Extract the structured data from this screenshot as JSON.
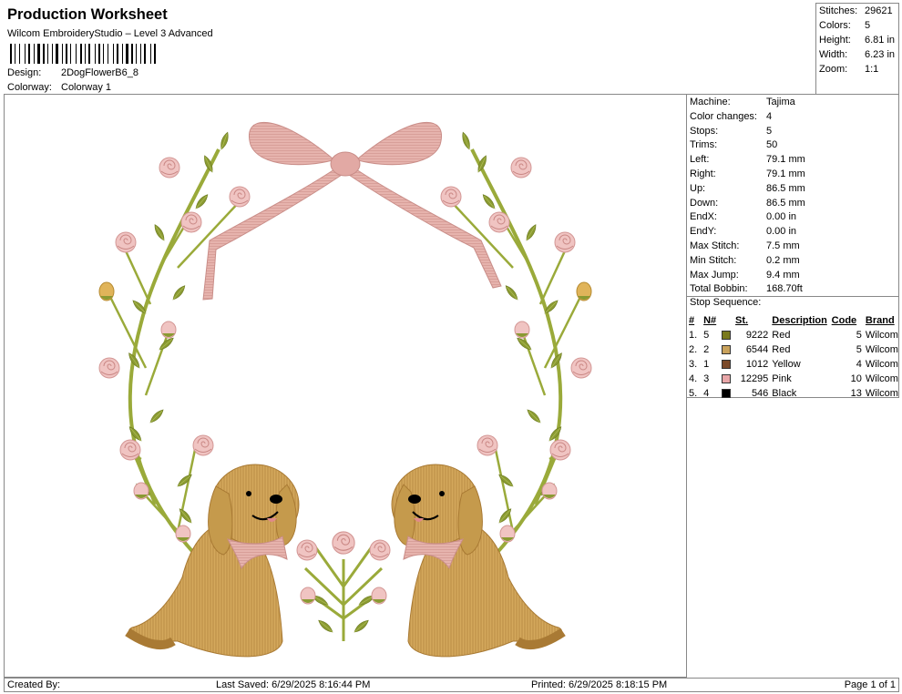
{
  "header": {
    "title": "Production Worksheet",
    "subtitle": "Wilcom EmbroideryStudio – Level 3 Advanced",
    "design_label": "Design:",
    "design_value": "2DogFlowerB6_8",
    "colorway_label": "Colorway:",
    "colorway_value": "Colorway 1"
  },
  "stats": [
    {
      "label": "Stitches:",
      "value": "29621"
    },
    {
      "label": "Colors:",
      "value": "5"
    },
    {
      "label": "Height:",
      "value": "6.81 in"
    },
    {
      "label": "Width:",
      "value": "6.23 in"
    },
    {
      "label": "Zoom:",
      "value": "1:1"
    }
  ],
  "machine_info": [
    {
      "label": "Machine:",
      "value": "Tajima"
    },
    {
      "label": "Color changes:",
      "value": "4"
    },
    {
      "label": "Stops:",
      "value": "5"
    },
    {
      "label": "Trims:",
      "value": "50"
    },
    {
      "label": "Left:",
      "value": "79.1 mm"
    },
    {
      "label": "Right:",
      "value": "79.1 mm"
    },
    {
      "label": "Up:",
      "value": "86.5 mm"
    },
    {
      "label": "Down:",
      "value": "86.5 mm"
    },
    {
      "label": "EndX:",
      "value": "0.00 in"
    },
    {
      "label": "EndY:",
      "value": "0.00 in"
    },
    {
      "label": "Max Stitch:",
      "value": "7.5 mm"
    },
    {
      "label": "Min Stitch:",
      "value": "0.2 mm"
    },
    {
      "label": "Max Jump:",
      "value": "9.4 mm"
    },
    {
      "label": "Total Bobbin:",
      "value": "168.70ft"
    }
  ],
  "stop_sequence": {
    "title": "Stop Sequence:",
    "headers": {
      "no": "#",
      "n": "N#",
      "st": "St.",
      "desc": "Description",
      "code": "Code",
      "brand": "Brand"
    },
    "rows": [
      {
        "no": "1.",
        "n": "5",
        "color": "#7a7a1e",
        "st": "9222",
        "desc": "Red",
        "code": "5",
        "brand": "Wilcom"
      },
      {
        "no": "2.",
        "n": "2",
        "color": "#c9a25c",
        "st": "6544",
        "desc": "Red",
        "code": "5",
        "brand": "Wilcom"
      },
      {
        "no": "3.",
        "n": "1",
        "color": "#7b4a2a",
        "st": "1012",
        "desc": "Yellow",
        "code": "4",
        "brand": "Wilcom"
      },
      {
        "no": "4.",
        "n": "3",
        "color": "#e8a6a8",
        "st": "12295",
        "desc": "Pink",
        "code": "10",
        "brand": "Wilcom"
      },
      {
        "no": "5.",
        "n": "4",
        "color": "#000000",
        "st": "546",
        "desc": "Black",
        "code": "13",
        "brand": "Wilcom"
      }
    ]
  },
  "footer": {
    "created_by": "Created By:",
    "last_saved": "Last Saved: 6/29/2025 8:16:44 PM",
    "printed": "Printed: 6/29/2025 8:18:15 PM",
    "page": "Page 1 of 1"
  },
  "colors": {
    "leaf": "#8a9a32",
    "stem": "#9aaa3a",
    "rose": "#f0c4c2",
    "rose_dark": "#d99a98",
    "bow": "#e2a9a4",
    "dog": "#d4a85c",
    "dog_dark": "#b3863c",
    "bud_yellow": "#e0b45a"
  }
}
